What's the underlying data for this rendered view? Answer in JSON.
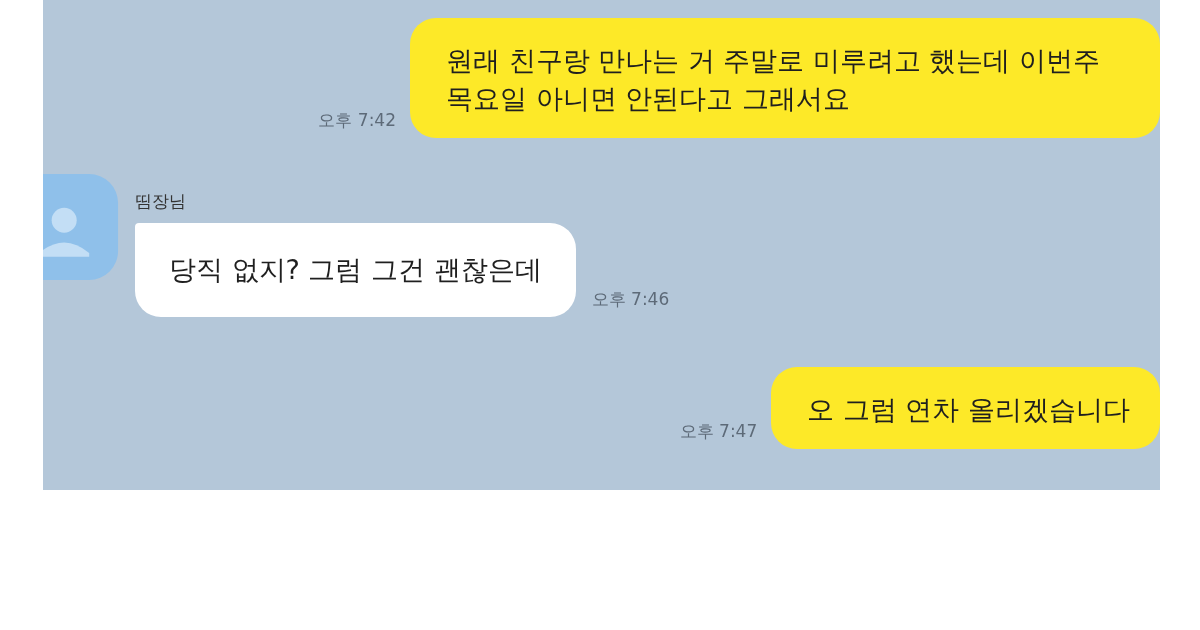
{
  "messages": [
    {
      "kind": "sent",
      "text": "원래 친구랑 만나는 거 주말로 미루려고 했는데 이번주 목요일 아니면 안된다고 그래서요",
      "time": "오후 7:42"
    },
    {
      "kind": "received",
      "sender": "띰장님",
      "text": "당직 없지? 그럼 그건 괜찮은데",
      "time": "오후 7:46"
    },
    {
      "kind": "sent",
      "text": "오 그럼 연차 올리겠습니다",
      "time": "오후 7:47"
    }
  ]
}
